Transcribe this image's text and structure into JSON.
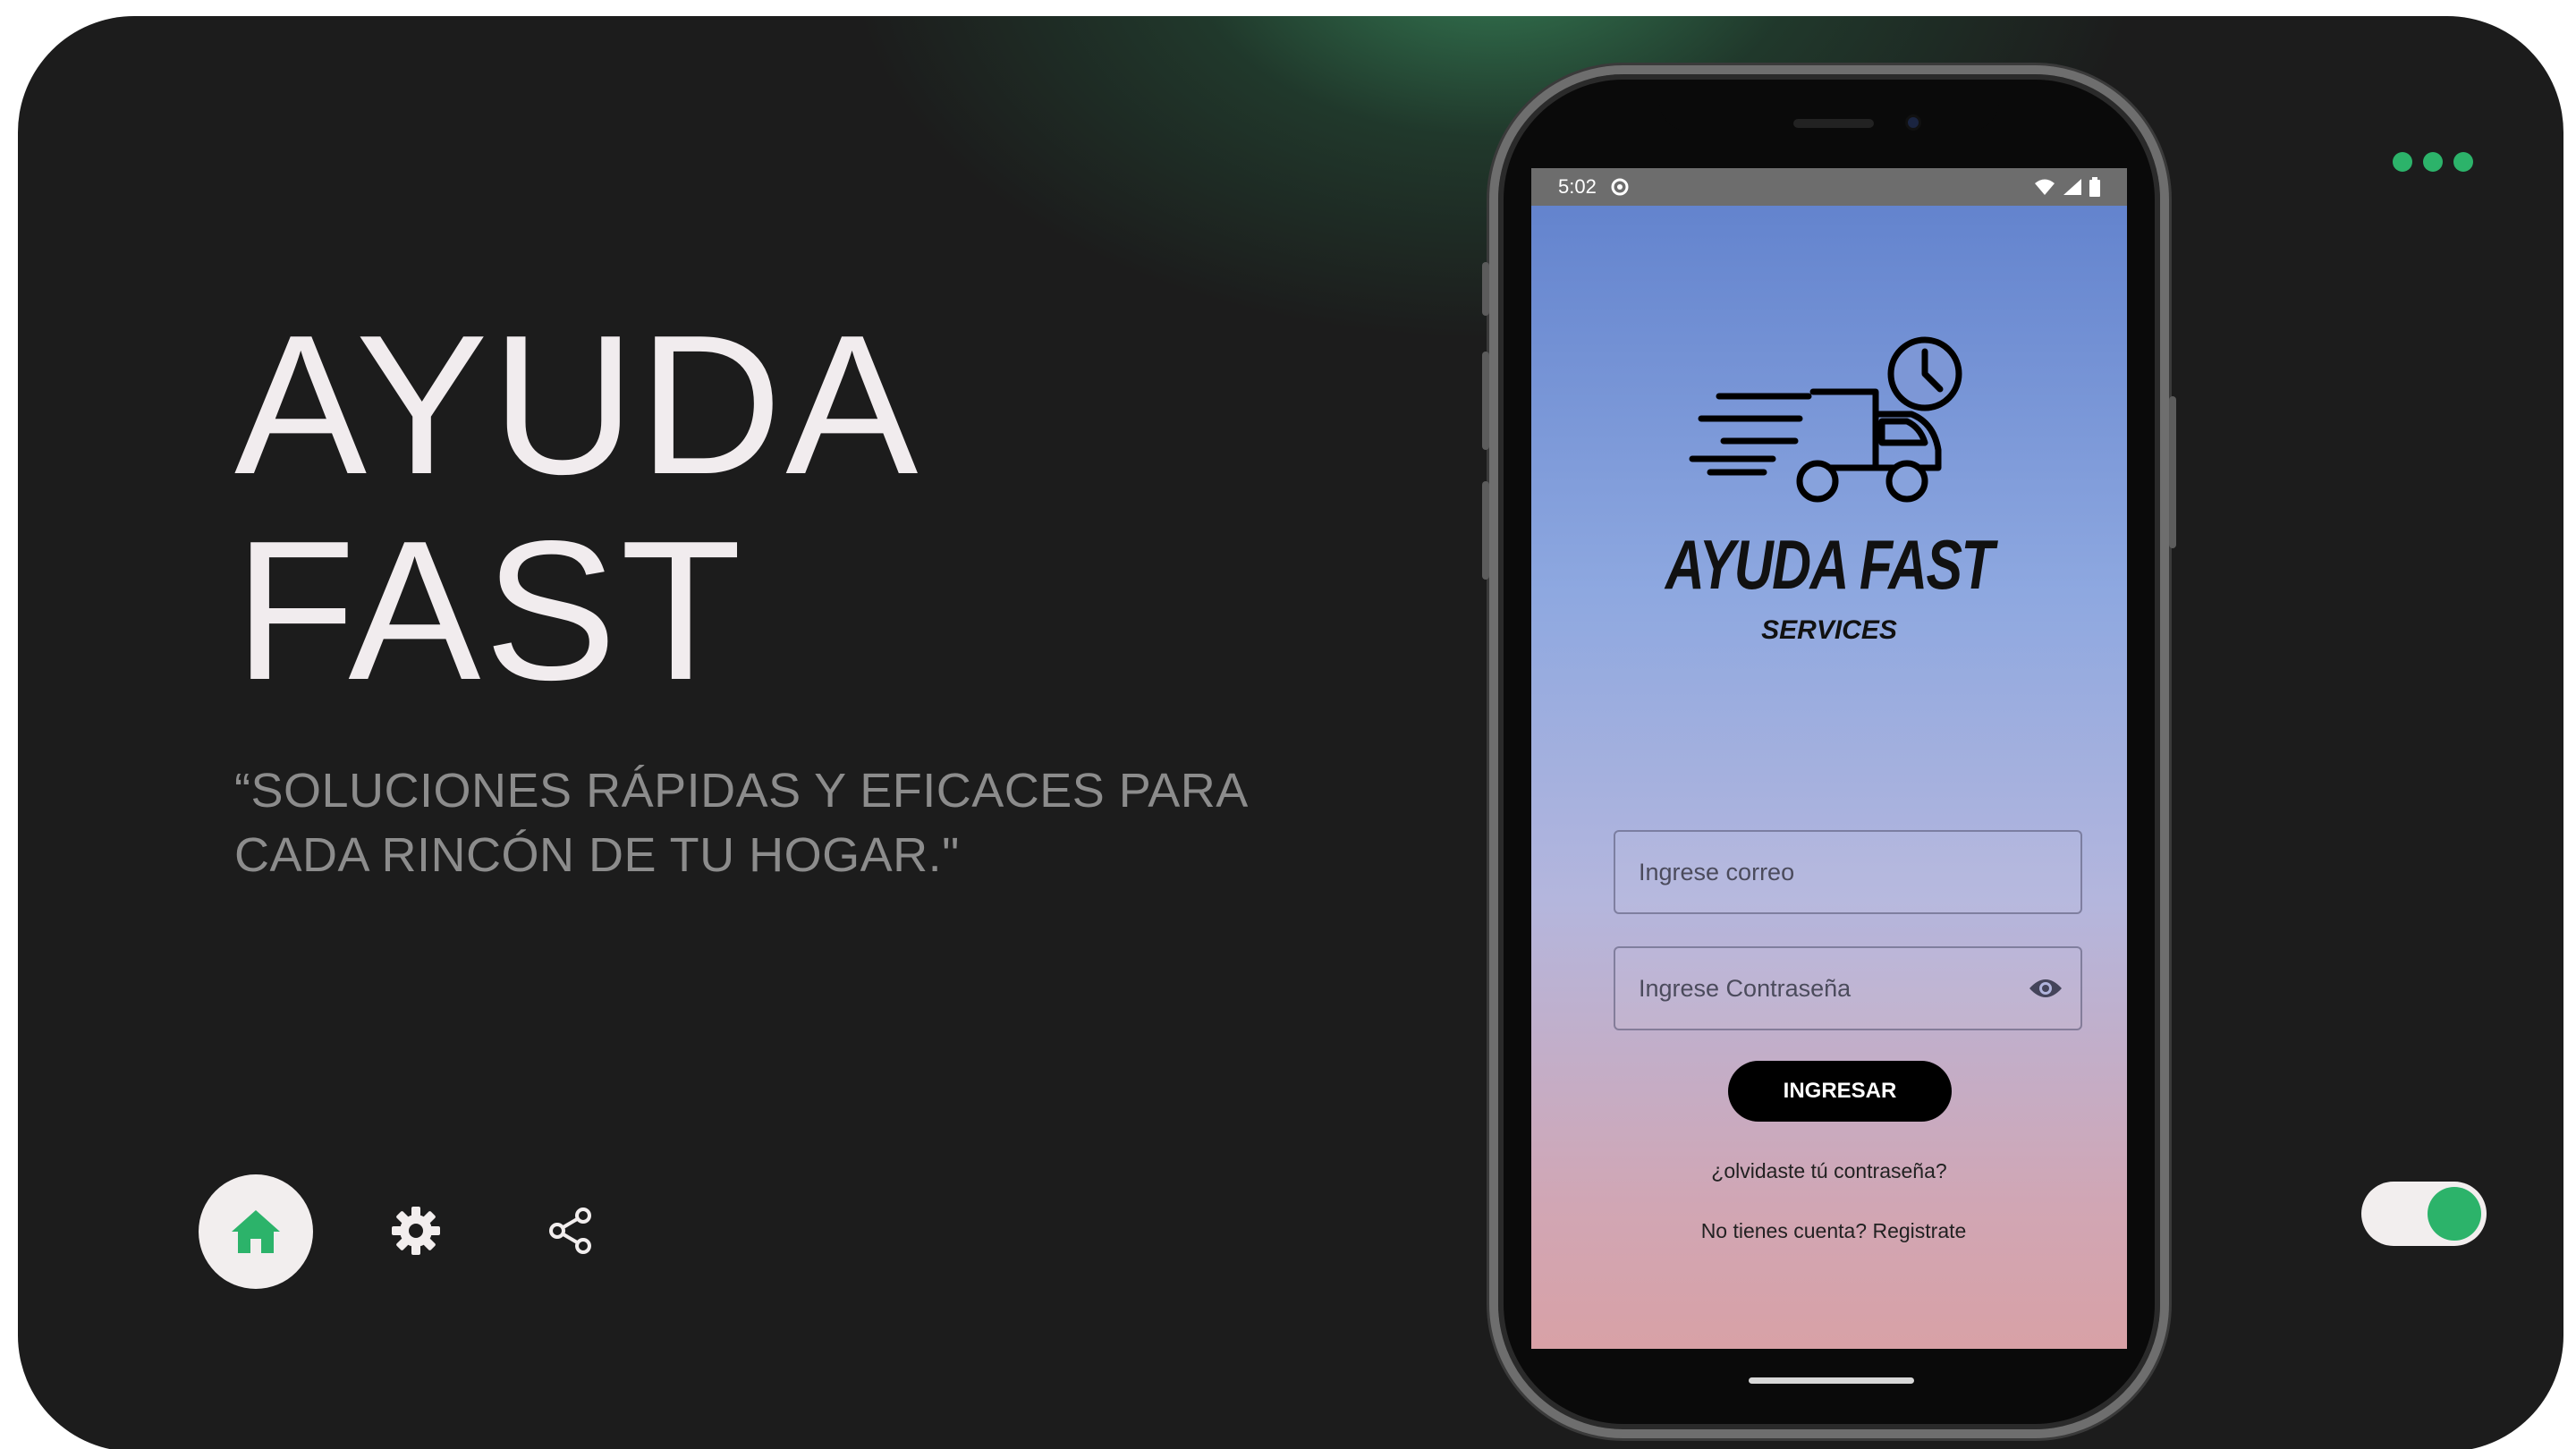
{
  "hero": {
    "title_line1": "AYUDA",
    "title_line2": "FAST",
    "tagline_line1": "“SOLUCIONES RÁPIDAS Y EFICACES PARA",
    "tagline_line2": "CADA RINCÓN DE TU HOGAR.\""
  },
  "nav": {
    "items": [
      {
        "icon": "home-icon",
        "active": true
      },
      {
        "icon": "gear-icon",
        "active": false
      },
      {
        "icon": "share-icon",
        "active": false
      }
    ]
  },
  "colors": {
    "background": "#1c1c1c",
    "accent": "#2cb36a",
    "light": "#f2eeee",
    "title": "#f1ecee",
    "tagline": "#8c8c8c"
  },
  "menu": {
    "icon": "more-dots-icon"
  },
  "toggle": {
    "state": "on"
  },
  "phone": {
    "status_bar": {
      "time": "5:02",
      "icons": [
        "notification-icon",
        "wifi-icon",
        "signal-icon",
        "battery-icon"
      ]
    },
    "app": {
      "logo_icon": "delivery-truck-clock-icon",
      "brand": "AYUDA FAST",
      "brand_sub": "SERVICES",
      "email_placeholder": "Ingrese correo",
      "password_placeholder": "Ingrese Contraseña",
      "submit_label": "INGRESAR",
      "forgot_link": "¿olvidaste tú contraseña?",
      "register_link": "No tienes cuenta? Registrate"
    }
  }
}
